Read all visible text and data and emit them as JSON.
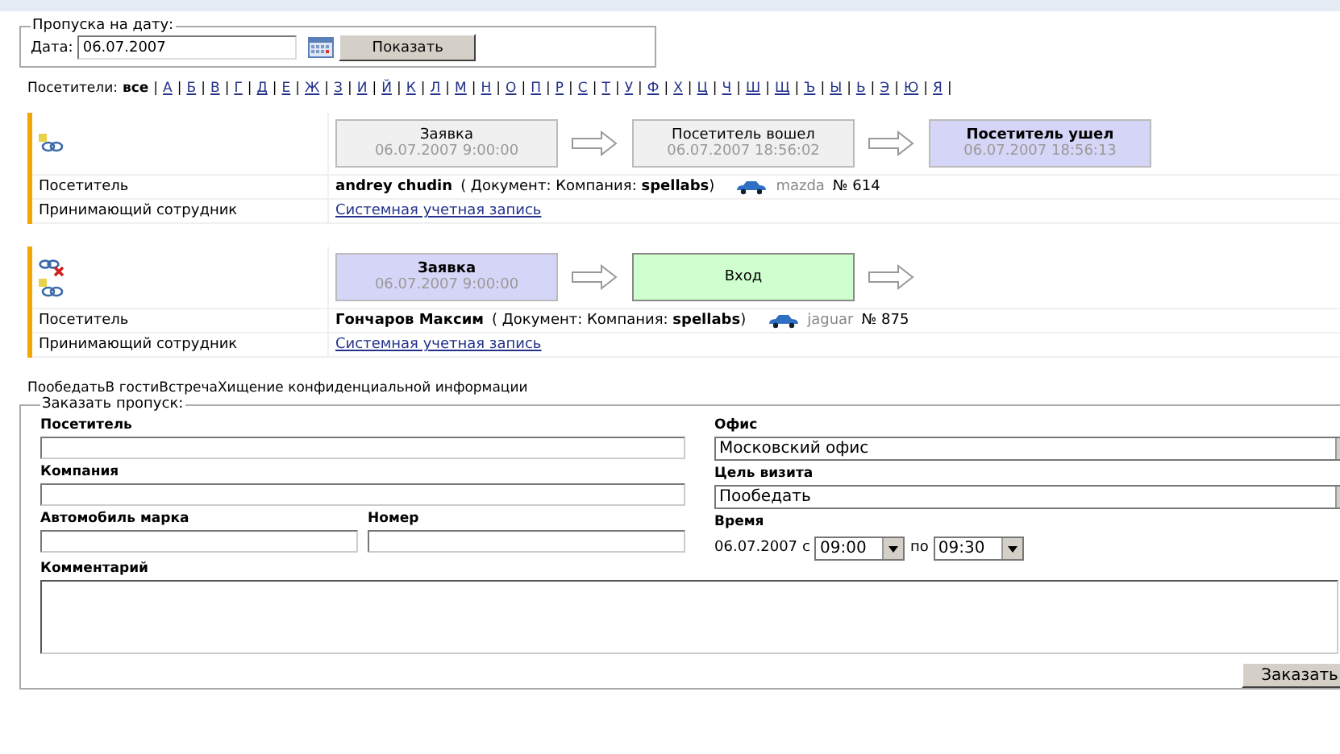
{
  "date_filter": {
    "legend": "Пропуска на дату:",
    "label": "Дата:",
    "value": "06.07.2007",
    "button": "Показать"
  },
  "letters": {
    "label": "Посетители:",
    "items": [
      {
        "text": "все",
        "selected": true
      },
      {
        "text": "А",
        "selected": false
      },
      {
        "text": "Б",
        "selected": false
      },
      {
        "text": "В",
        "selected": false
      },
      {
        "text": "Г",
        "selected": false
      },
      {
        "text": "Д",
        "selected": false
      },
      {
        "text": "Е",
        "selected": false
      },
      {
        "text": "Ж",
        "selected": false
      },
      {
        "text": "З",
        "selected": false
      },
      {
        "text": "И",
        "selected": false
      },
      {
        "text": "Й",
        "selected": false
      },
      {
        "text": "К",
        "selected": false
      },
      {
        "text": "Л",
        "selected": false
      },
      {
        "text": "М",
        "selected": false
      },
      {
        "text": "Н",
        "selected": false
      },
      {
        "text": "О",
        "selected": false
      },
      {
        "text": "П",
        "selected": false
      },
      {
        "text": "Р",
        "selected": false
      },
      {
        "text": "С",
        "selected": false
      },
      {
        "text": "Т",
        "selected": false
      },
      {
        "text": "У",
        "selected": false
      },
      {
        "text": "Ф",
        "selected": false
      },
      {
        "text": "Х",
        "selected": false
      },
      {
        "text": "Ц",
        "selected": false
      },
      {
        "text": "Ч",
        "selected": false
      },
      {
        "text": "Ш",
        "selected": false
      },
      {
        "text": "Щ",
        "selected": false
      },
      {
        "text": "Ъ",
        "selected": false
      },
      {
        "text": "Ы",
        "selected": false
      },
      {
        "text": "Ь",
        "selected": false
      },
      {
        "text": "Э",
        "selected": false
      },
      {
        "text": "Ю",
        "selected": false
      },
      {
        "text": "Я",
        "selected": false
      }
    ],
    "separator": "|"
  },
  "visits": [
    {
      "can_cancel": false,
      "steps": [
        {
          "kind": "done",
          "label": "Заявка",
          "time": "06.07.2007 9:00:00"
        },
        {
          "kind": "done",
          "label": "Посетитель вошел",
          "time": "06.07.2007 18:56:02"
        },
        {
          "kind": "current",
          "label": "Посетитель ушел",
          "time": "06.07.2007 18:56:13"
        }
      ],
      "trailing_arrow": false,
      "visitor_label": "Посетитель",
      "visitor": "andrey chudin",
      "document": "( Документ: Компания: **spellabs**)",
      "car": "mazda",
      "number": "№ 614",
      "employee_label": "Принимающий сотрудник",
      "employee": "Системная учетная запись"
    },
    {
      "can_cancel": true,
      "steps": [
        {
          "kind": "current",
          "label": "Заявка",
          "time": "06.07.2007 9:00:00"
        },
        {
          "kind": "action",
          "label": "Вход"
        }
      ],
      "trailing_arrow": true,
      "visitor_label": "Посетитель",
      "visitor": "Гончаров Максим",
      "document": "( Документ: Компания: **spellabs**)",
      "car": "jaguar",
      "number": "№ 875",
      "employee_label": "Принимающий сотрудник",
      "employee": "Системная учетная запись"
    }
  ],
  "purposes_text": "ПообедатьВ гостиВстречаХищение конфиденциальной информации",
  "order": {
    "legend": "Заказать пропуск:",
    "visitor_label": "Посетитель",
    "company_label": "Компания",
    "car_label": "Автомобиль марка",
    "number_label": "Номер",
    "office_label": "Офис",
    "office": "Московский офис",
    "purpose_label": "Цель визита",
    "purpose": "Пообедать",
    "time_label": "Время",
    "date": "06.07.2007",
    "from_label": "с",
    "from": "09:00",
    "to_label": "по",
    "to": "09:30",
    "comment_label": "Комментарий",
    "button": "Заказать"
  }
}
